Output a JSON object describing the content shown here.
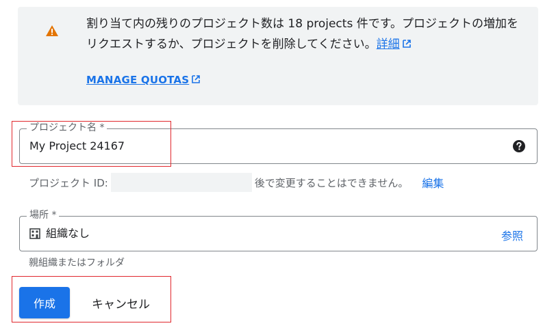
{
  "quota": {
    "message": "割り当て内の残りのプロジェクト数は 18 projects 件です。プロジェクトの増加をリクエストするか、プロジェクトを削除してください。",
    "details_link": "詳細",
    "manage_quotas": "MANAGE QUOTAS"
  },
  "project_name": {
    "label": "プロジェクト名 *",
    "value": "My Project 24167"
  },
  "project_id": {
    "prefix": "プロジェクト ID:",
    "suffix": "後で変更することはできません。",
    "edit_label": "編集"
  },
  "location": {
    "label": "場所 *",
    "value": "組織なし",
    "browse_label": "参照",
    "hint": "親組織またはフォルダ"
  },
  "actions": {
    "create_label": "作成",
    "cancel_label": "キャンセル"
  },
  "colors": {
    "accent": "#1a73e8",
    "warning": "#e37400",
    "highlight": "#e0262b",
    "panel": "#f1f3f4"
  }
}
